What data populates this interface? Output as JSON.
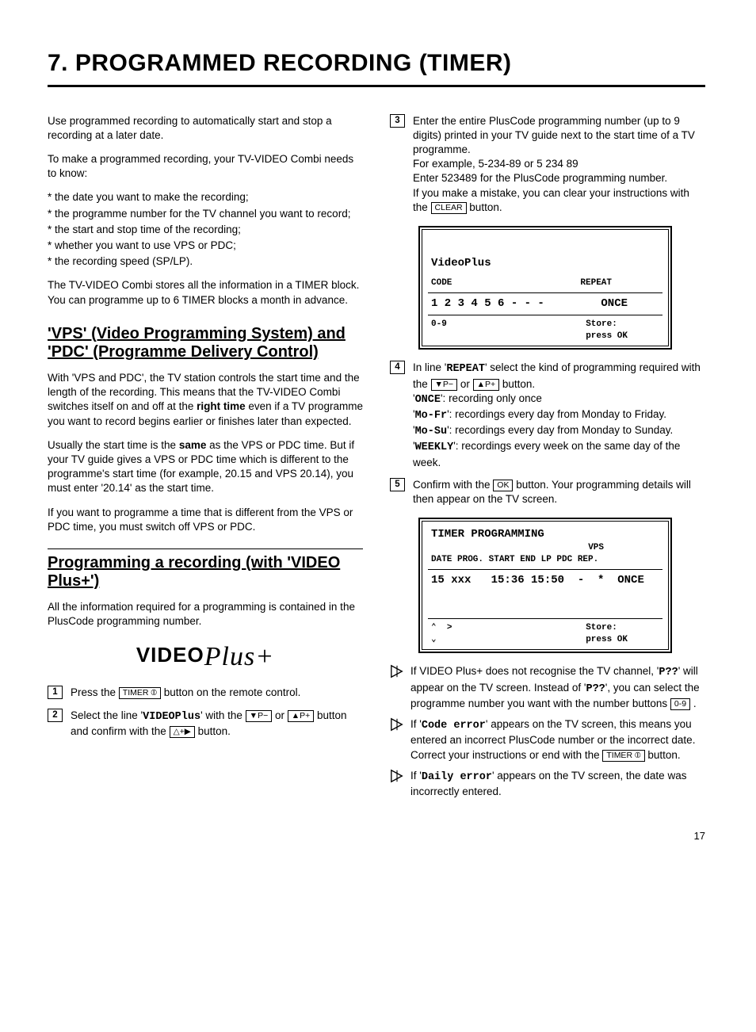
{
  "title": "7.    PROGRAMMED RECORDING (TIMER)",
  "page_number": "17",
  "left": {
    "intro1": "Use programmed recording to automatically start and stop a recording at a later date.",
    "intro2": "To make a programmed recording, your TV-VIDEO Combi needs to know:",
    "bullets": [
      "* the date you want to make the recording;",
      "* the programme number for the TV channel you want to record;",
      "* the start and stop time of the recording;",
      "* whether you want to use VPS or PDC;",
      "* the recording speed (SP/LP)."
    ],
    "intro3": "The TV-VIDEO Combi stores all the information in a TIMER block. You can programme up to 6 TIMER blocks a month in advance.",
    "vps_head": "'VPS' (Video Programming System) and 'PDC' (Programme Delivery Control)",
    "vps_p1a": "With 'VPS and PDC', the TV station controls the start time and the length of the recording. This means that the TV-VIDEO Combi switches itself on and off at the ",
    "vps_p1b": "right time",
    "vps_p1c": " even if a TV programme you want to record begins earlier or finishes later than expected.",
    "vps_p2a": "Usually the start time is the ",
    "vps_p2b": "same",
    "vps_p2c": " as the VPS or PDC time. But if your TV guide gives a VPS or PDC time which is different to the programme's start time (for example, 20.15 and VPS 20.14), you must enter '20.14' as the start time.",
    "vps_p3": "If you want to programme a time that is different from the VPS or PDC time, you must switch off VPS or PDC.",
    "prog_head": "Programming a recording (with 'VIDEO Plus+')",
    "prog_p1": "All the information required for a programming is contained in the PlusCode programming number.",
    "logo_a": "VIDEO",
    "logo_b": "Plus+",
    "step1a": "Press the ",
    "step1b": " button on the remote control.",
    "step2a": "Select the line '",
    "step2b": "VIDEOPlus",
    "step2c": "' with the ",
    "step2d": " or ",
    "step2e": " button and confirm with the ",
    "step2f": " button.",
    "btn_timer": "TIMER ⦶",
    "btn_pminus": "▼P−",
    "btn_pplus": "▲P+",
    "btn_play": "△+▶"
  },
  "right": {
    "step3a": "Enter the entire PlusCode programming number (up to 9 digits) printed in your TV guide next to the start time of a TV programme.",
    "step3b": "For example, 5-234-89 or 5 234 89",
    "step3c": "Enter 523489 for the PlusCode programming number.",
    "step3d": "If you make a mistake, you can clear your instructions with the ",
    "step3e": " button.",
    "btn_clear": "CLEAR",
    "screen1": {
      "title": "VideoPlus",
      "h1": "CODE",
      "h2": "REPEAT",
      "r1": "1 2 3 4 5 6 - - -",
      "r2": "ONCE",
      "f1": "0-9",
      "f2": "Store:\npress OK"
    },
    "step4a": "In line '",
    "step4b": "REPEAT",
    "step4c": "' select the kind of programming required with the ",
    "step4d": " or ",
    "step4e": " button.",
    "step4_once_a": "ONCE",
    "step4_once_b": "': recording only once",
    "step4_mofr_a": "Mo-Fr",
    "step4_mofr_b": "': recordings every day from Monday to Friday.",
    "step4_mosu_a": "Mo-Su",
    "step4_mosu_b": "': recordings every day from Monday to Sunday.",
    "step4_wk_a": "WEEKLY",
    "step4_wk_b": "': recordings every week on the same day of the week.",
    "step5a": "Confirm with the ",
    "step5b": " button. Your programming details will then appear on the TV screen.",
    "btn_ok": "OK",
    "screen2": {
      "title": "TIMER PROGRAMMING",
      "h": "DATE PROG. START END   LP PDC REP.",
      "h_vps": "VPS",
      "row": "15 xxx   15:36 15:50  -  *  ONCE",
      "f1": "⌃  >\n⌄",
      "f2": "Store:\npress OK"
    },
    "tip1a": "If VIDEO Plus+ does not recognise the TV channel, '",
    "tip1b": "P??",
    "tip1c": "' will appear on the TV screen. Instead of '",
    "tip1d": "P??",
    "tip1e": "', you can select the programme number you want with the number buttons ",
    "btn_09": "0-9",
    "tip1f": " .",
    "tip2a": "If '",
    "tip2b": "Code error",
    "tip2c": "' appears on the TV screen, this means you entered an incorrect PlusCode number or the incorrect date. Correct your instructions or end with the ",
    "tip2d": " button.",
    "tip3a": "If '",
    "tip3b": "Daily error",
    "tip3c": "' appears on the TV screen, the date was incorrectly entered."
  }
}
